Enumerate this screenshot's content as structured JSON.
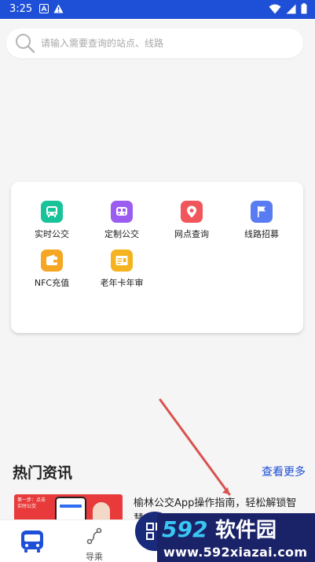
{
  "status_bar": {
    "time": "3:25",
    "background": "#1e4fd7"
  },
  "search": {
    "placeholder": "请输入需要查询的站点、线路"
  },
  "services": [
    {
      "label": "实时公交",
      "icon": "bus-icon",
      "color": "#19c39a"
    },
    {
      "label": "定制公交",
      "icon": "custom-bus-icon",
      "color": "#9b5cf0"
    },
    {
      "label": "网点查询",
      "icon": "location-pin-icon",
      "color": "#f0565a"
    },
    {
      "label": "线路招募",
      "icon": "flag-icon",
      "color": "#5a7cf2"
    },
    {
      "label": "NFC充值",
      "icon": "wallet-icon",
      "color": "#f5a623"
    },
    {
      "label": "老年卡年审",
      "icon": "id-card-icon",
      "color": "#f5b31f"
    }
  ],
  "news": {
    "section_title": "热门资讯",
    "more_label": "查看更多",
    "items": [
      {
        "headline": "榆林公交App操作指南，轻松解锁智慧出行",
        "thumb_text": "第一步：点击实时公交"
      }
    ]
  },
  "bottom_nav": {
    "items": [
      {
        "label": "",
        "icon": "bus-icon",
        "active": true
      },
      {
        "label": "导乘",
        "icon": "route-icon",
        "active": false
      },
      {
        "label": "",
        "icon": "qr-code-icon",
        "active": false
      }
    ]
  },
  "watermark": {
    "brand": "592软件园",
    "url": "www.592xiazai.com"
  },
  "colors": {
    "accent": "#1e4fd7",
    "annotation_arrow": "#d9534f"
  }
}
